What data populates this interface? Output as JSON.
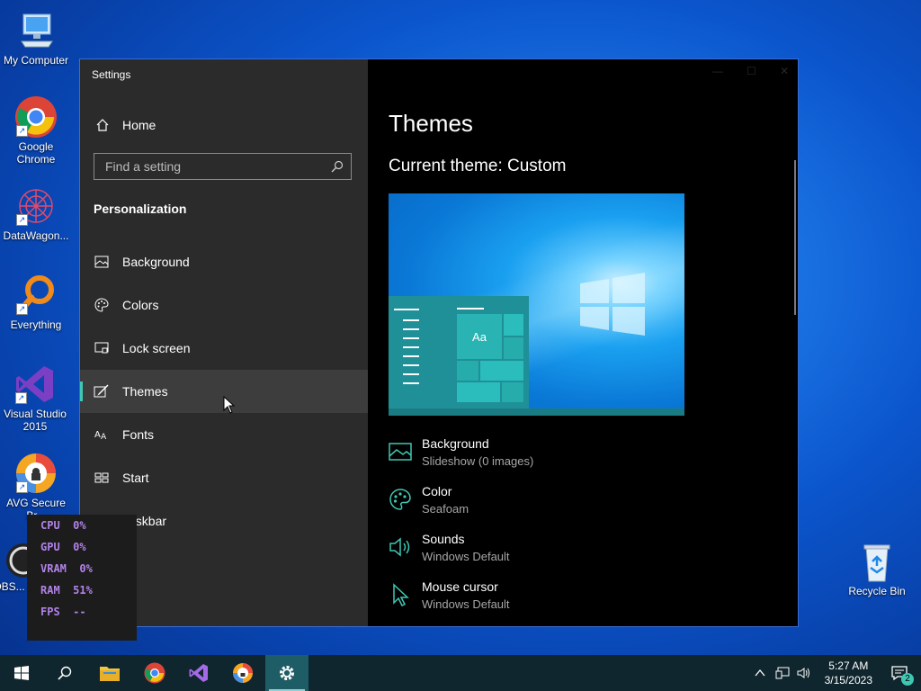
{
  "desktop": {
    "icons": [
      {
        "label": "My Computer"
      },
      {
        "label": "Google Chrome"
      },
      {
        "label": "DataWagon..."
      },
      {
        "label": "Everything"
      },
      {
        "label": "Visual Studio 2015"
      },
      {
        "label": "AVG Secure Br..."
      },
      {
        "label": "OBS..."
      },
      {
        "label": "Recycle Bin"
      }
    ]
  },
  "window": {
    "title": "Settings",
    "home_label": "Home",
    "search_placeholder": "Find a setting",
    "section_title": "Personalization",
    "nav": [
      {
        "label": "Background",
        "icon": "picture-icon"
      },
      {
        "label": "Colors",
        "icon": "palette-icon"
      },
      {
        "label": "Lock screen",
        "icon": "lock-screen-icon"
      },
      {
        "label": "Themes",
        "icon": "brush-icon",
        "active": true
      },
      {
        "label": "Fonts",
        "icon": "fonts-icon"
      },
      {
        "label": "Start",
        "icon": "start-icon"
      },
      {
        "label": "Taskbar",
        "icon": "taskbar-icon"
      }
    ],
    "page_title": "Themes",
    "current_theme": "Current theme: Custom",
    "preview_text": "Aa",
    "options": [
      {
        "name": "Background",
        "value": "Slideshow (0 images)"
      },
      {
        "name": "Color",
        "value": "Seafoam"
      },
      {
        "name": "Sounds",
        "value": "Windows Default"
      },
      {
        "name": "Mouse cursor",
        "value": "Windows Default"
      }
    ]
  },
  "hud": {
    "rows": [
      {
        "label": "CPU",
        "value": "0%"
      },
      {
        "label": "GPU",
        "value": "0%"
      },
      {
        "label": "VRAM",
        "value": "0%"
      },
      {
        "label": "RAM",
        "value": "51%"
      },
      {
        "label": "FPS",
        "value": "--"
      }
    ]
  },
  "taskbar": {
    "time": "5:27 AM",
    "date": "3/15/2023",
    "notification_count": "2"
  },
  "colors": {
    "accent": "#3fc7b4",
    "sidebar_bg": "#2b2b2b",
    "taskbar_bg": "#10262e"
  }
}
